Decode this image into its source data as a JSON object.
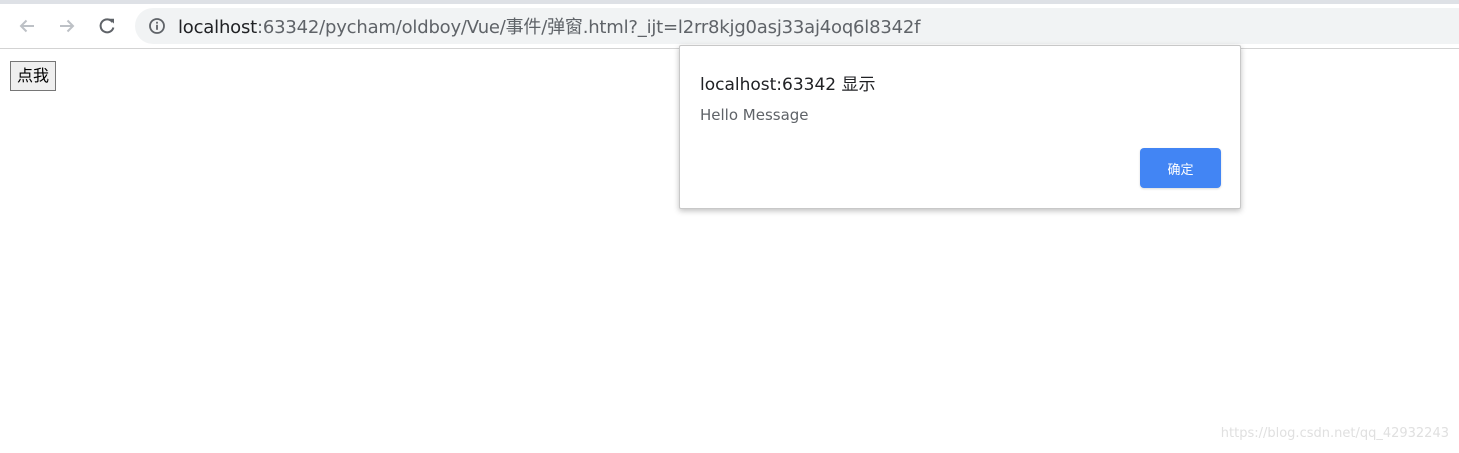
{
  "browser": {
    "url_host": "localhost",
    "url_rest": ":63342/pycham/oldboy/Vue/事件/弹窗.html?_ijt=l2rr8kjg0asj33aj4oq6l8342f",
    "icons": {
      "back": "arrow-left",
      "forward": "arrow-right",
      "reload": "reload",
      "site_info": "info-circle"
    }
  },
  "page": {
    "button_label": "点我"
  },
  "alert": {
    "title": "localhost:63342 显示",
    "message": "Hello Message",
    "ok_label": "确定",
    "accent_color": "#4285f4"
  },
  "watermark": {
    "text": "https://blog.csdn.net/qq_42932243"
  }
}
